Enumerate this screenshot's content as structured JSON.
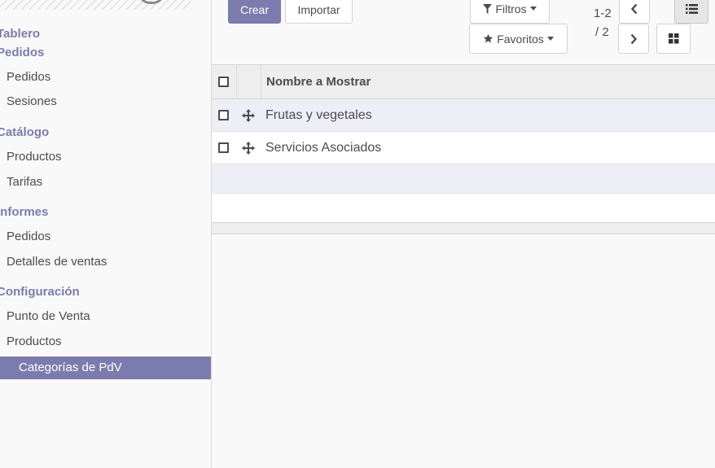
{
  "sidebar": {
    "sections": [
      {
        "label": "Tablero"
      },
      {
        "label": "Pedidos",
        "items": [
          "Pedidos",
          "Sesiones"
        ]
      },
      {
        "label": "Catálogo",
        "items": [
          "Productos",
          "Tarifas"
        ]
      },
      {
        "label": "Informes",
        "items": [
          "Pedidos",
          "Detalles de ventas"
        ]
      },
      {
        "label": "Configuración",
        "items": [
          "Punto de Venta",
          "Productos",
          "Categorías de PdV"
        ]
      }
    ],
    "active_item": "Categorías de PdV"
  },
  "control_panel": {
    "create_label": "Crear",
    "import_label": "Importar",
    "filters_label": "Filtros",
    "favorites_label": "Favoritos",
    "pager_range": "1-2",
    "pager_total": "/ 2"
  },
  "list": {
    "columns": [
      "Nombre a Mostrar"
    ],
    "rows": [
      {
        "name": "Frutas y vegetales"
      },
      {
        "name": "Servicios Asociados"
      }
    ]
  },
  "colors": {
    "accent": "#7c7bad",
    "header_bg": "#eeeeee",
    "row_alt": "#eeeef6"
  }
}
